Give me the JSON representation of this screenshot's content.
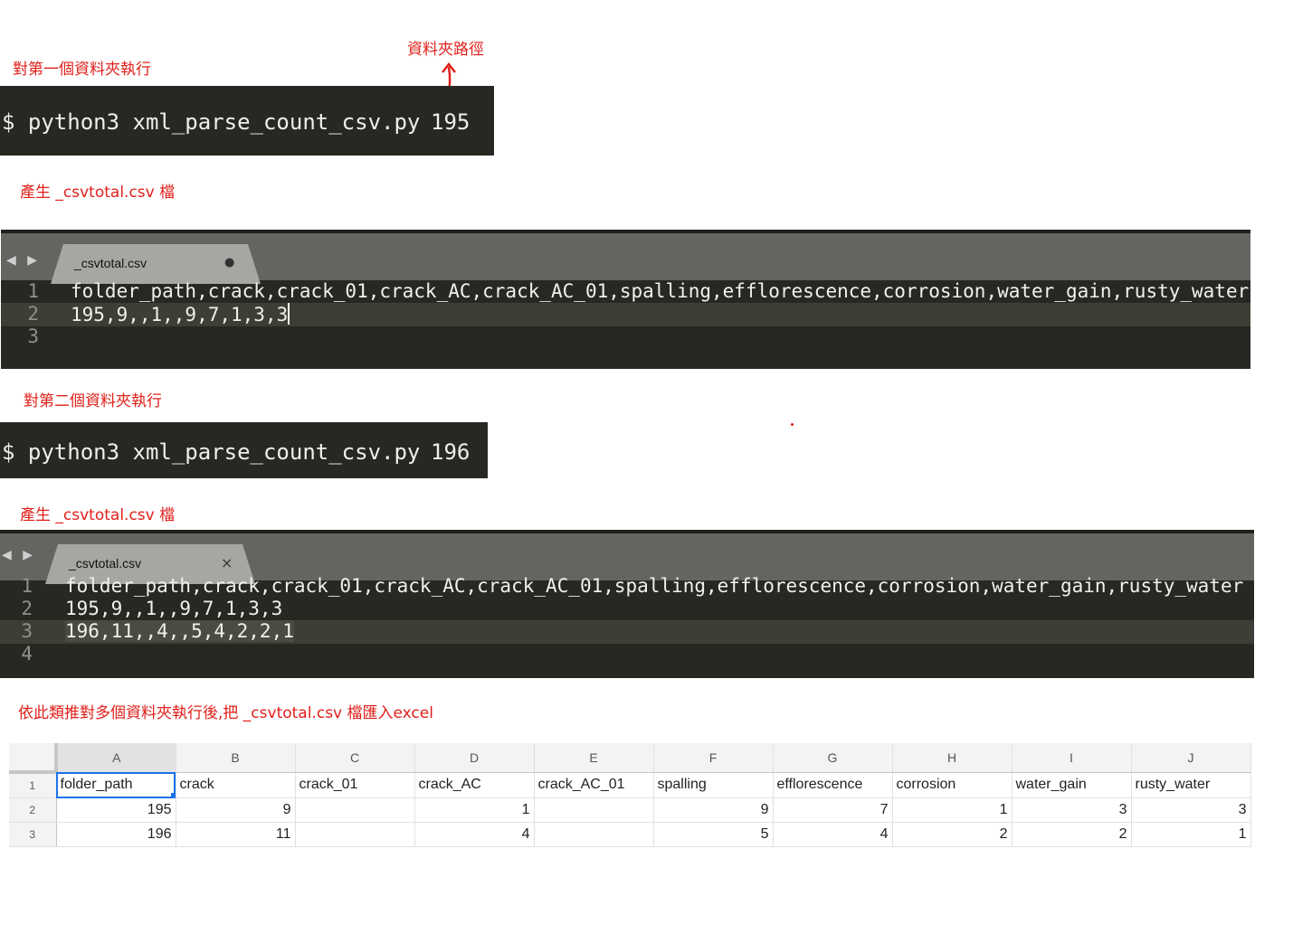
{
  "notes": {
    "step1": "對第一個資料夾執行",
    "folder_path_label": "資料夾路徑",
    "produce1": "產生 _csvtotal.csv 檔",
    "step2": "對第二個資料夾執行",
    "produce2": "產生 _csvtotal.csv 檔",
    "final": "依此類推對多個資料夾執行後,把 _csvtotal.csv 檔匯入excel"
  },
  "terminal1": {
    "command": "$ python3 xml_parse_count_csv.py",
    "arg": "195"
  },
  "terminal2": {
    "command": "$ python3 xml_parse_count_csv.py",
    "arg": "196"
  },
  "editor1": {
    "tab_name": "_csvtotal.csv",
    "tab_state": "●",
    "nav": "◀ ▶",
    "lines": [
      {
        "num": "1",
        "text": "folder_path,crack,crack_01,crack_AC,crack_AC_01,spalling,efflorescence,corrosion,water_gain,rusty_water"
      },
      {
        "num": "2",
        "text": "195,9,,1,,9,7,1,3,3"
      },
      {
        "num": "3",
        "text": ""
      }
    ]
  },
  "editor2": {
    "tab_name": "_csvtotal.csv",
    "tab_state": "×",
    "nav": "◀ ▶",
    "lines": [
      {
        "num": "1",
        "text": "folder_path,crack,crack_01,crack_AC,crack_AC_01,spalling,efflorescence,corrosion,water_gain,rusty_water"
      },
      {
        "num": "2",
        "text": "195,9,,1,,9,7,1,3,3"
      },
      {
        "num": "3",
        "text": "196,11,,4,,5,4,2,2,1"
      },
      {
        "num": "4",
        "text": ""
      }
    ]
  },
  "sheet": {
    "columns": [
      "A",
      "B",
      "C",
      "D",
      "E",
      "F",
      "G",
      "H",
      "I",
      "J"
    ],
    "row_numbers": [
      "1",
      "2",
      "3"
    ],
    "header": [
      "folder_path",
      "crack",
      "crack_01",
      "crack_AC",
      "crack_AC_01",
      "spalling",
      "efflorescence",
      "corrosion",
      "water_gain",
      "rusty_water"
    ],
    "rows": [
      [
        "195",
        "9",
        "",
        "1",
        "",
        "9",
        "7",
        "1",
        "3",
        "3"
      ],
      [
        "196",
        "11",
        "",
        "4",
        "",
        "5",
        "4",
        "2",
        "2",
        "1"
      ]
    ]
  },
  "colors": {
    "annotation": "#e0201b",
    "terminal_bg": "#272822",
    "selection": "#1a73e8"
  }
}
